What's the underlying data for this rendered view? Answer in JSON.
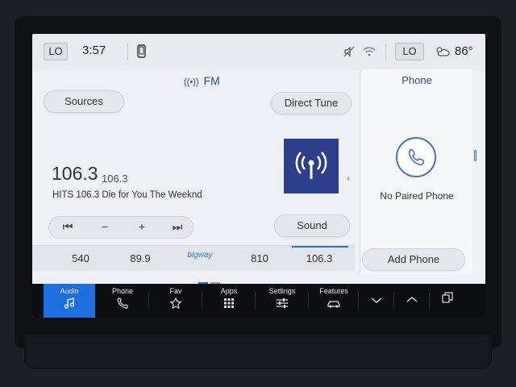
{
  "status": {
    "climate_left": "LO",
    "time": "3:57",
    "climate_right": "LO",
    "temperature": "86°",
    "icons": [
      "phone-connect-icon",
      "mute-icon",
      "wifi-icon",
      "weather-icon"
    ]
  },
  "audio": {
    "band": "FM",
    "sources_label": "Sources",
    "direct_tune_label": "Direct Tune",
    "frequency": "106.3",
    "frequency_small": "106.3",
    "radio_text": "HITS 106.3 Die for You The Weeknd",
    "sound_label": "Sound",
    "controls": [
      "seek-back",
      "minus",
      "plus",
      "seek-forward"
    ],
    "control_glyphs": {
      "seek_back": "⏮",
      "minus": "−",
      "plus": "+",
      "seek_forward": "⏭"
    },
    "presets": [
      "540",
      "89.9",
      "",
      "810",
      "106.3"
    ],
    "preset_logo_text": "bigway",
    "active_preset_index": 4
  },
  "phone_panel": {
    "title": "Phone",
    "status": "No Paired Phone",
    "add_phone_label": "Add Phone"
  },
  "nav": {
    "items": [
      {
        "label": "Audio",
        "icon": "music-note-icon"
      },
      {
        "label": "Phone",
        "icon": "phone-icon"
      },
      {
        "label": "Fav",
        "icon": "star-icon"
      },
      {
        "label": "Apps",
        "icon": "grid-icon"
      },
      {
        "label": "Settings",
        "icon": "sliders-icon"
      },
      {
        "label": "Features",
        "icon": "car-icon"
      },
      {
        "label": "",
        "icon": "chevron-down-icon"
      },
      {
        "label": "",
        "icon": "chevron-up-icon"
      },
      {
        "label": "",
        "icon": "window-stack-icon"
      }
    ],
    "active": "Audio"
  },
  "colors": {
    "accent": "#1d6fe0",
    "title_blue": "#1b4f9a",
    "station_art": "#2d3e8a"
  }
}
